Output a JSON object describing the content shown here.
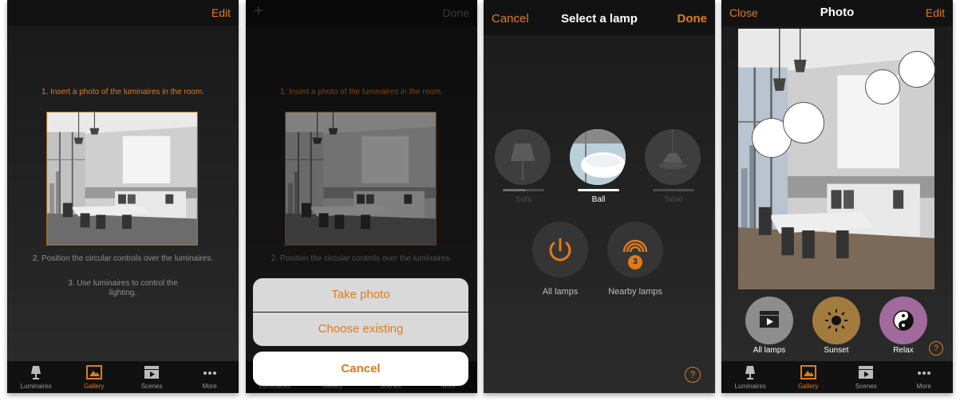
{
  "tabs": [
    {
      "label": "Luminaires",
      "icon": "lamp-icon"
    },
    {
      "label": "Gallery",
      "icon": "gallery-icon"
    },
    {
      "label": "Scenes",
      "icon": "clapper-icon"
    },
    {
      "label": "More",
      "icon": "more-icon"
    }
  ],
  "screen1": {
    "edit_label": "Edit",
    "step1": "1. Insert a photo of the luminaires in the room.",
    "step2": "2. Position the circular controls over the luminaires.",
    "step3": "3. Use luminaires to control the lighting."
  },
  "screen2": {
    "add_label": "+",
    "done_label": "Done",
    "take_photo": "Take photo",
    "choose_existing": "Choose existing",
    "cancel": "Cancel"
  },
  "screen3": {
    "cancel_label": "Cancel",
    "title": "Select a lamp",
    "done_label": "Done",
    "lamps": [
      {
        "label": "Sofa",
        "selected": false
      },
      {
        "label": "Ball",
        "selected": true
      },
      {
        "label": "Table",
        "selected": false
      }
    ],
    "all_lamps": "All lamps",
    "nearby_lamps": "Nearby lamps",
    "nearby_count": "3",
    "help": "?"
  },
  "screen4": {
    "close_label": "Close",
    "title": "Photo",
    "edit_label": "Edit",
    "scenes": [
      {
        "label": "All lamps",
        "color": "#8d8d8d",
        "icon": "clapper-icon"
      },
      {
        "label": "Sunset",
        "color": "#a27b3e",
        "icon": "sun-icon"
      },
      {
        "label": "Relax",
        "color": "#a06a9c",
        "icon": "yin-yang-icon"
      }
    ],
    "help": "?"
  },
  "colors": {
    "accent": "#e07b1a",
    "background": "#1e1e1e"
  }
}
